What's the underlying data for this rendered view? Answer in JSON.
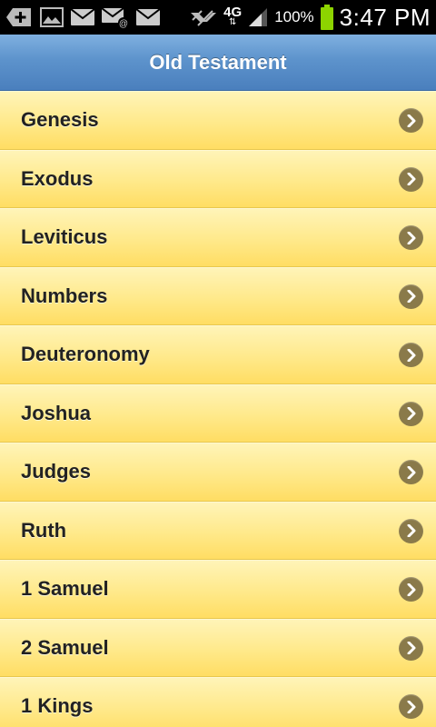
{
  "status_bar": {
    "left_icons": [
      "add-icon",
      "image-icon",
      "mail-icon",
      "mail-at-icon",
      "mail-icon"
    ],
    "network_type": "4G",
    "battery_percent": "100%",
    "time": "3:47 PM"
  },
  "header": {
    "title": "Old Testament"
  },
  "books": [
    {
      "label": "Genesis"
    },
    {
      "label": "Exodus"
    },
    {
      "label": "Leviticus"
    },
    {
      "label": "Numbers"
    },
    {
      "label": "Deuteronomy"
    },
    {
      "label": "Joshua"
    },
    {
      "label": "Judges"
    },
    {
      "label": "Ruth"
    },
    {
      "label": "1 Samuel"
    },
    {
      "label": "2 Samuel"
    },
    {
      "label": "1 Kings"
    }
  ],
  "colors": {
    "header_top": "#7fb0e0",
    "header_bottom": "#4a7fbd",
    "item_top": "#fff4b8",
    "item_bottom": "#ffdd63",
    "chevron_bg": "#8a7a4a",
    "battery": "#8dd400"
  }
}
